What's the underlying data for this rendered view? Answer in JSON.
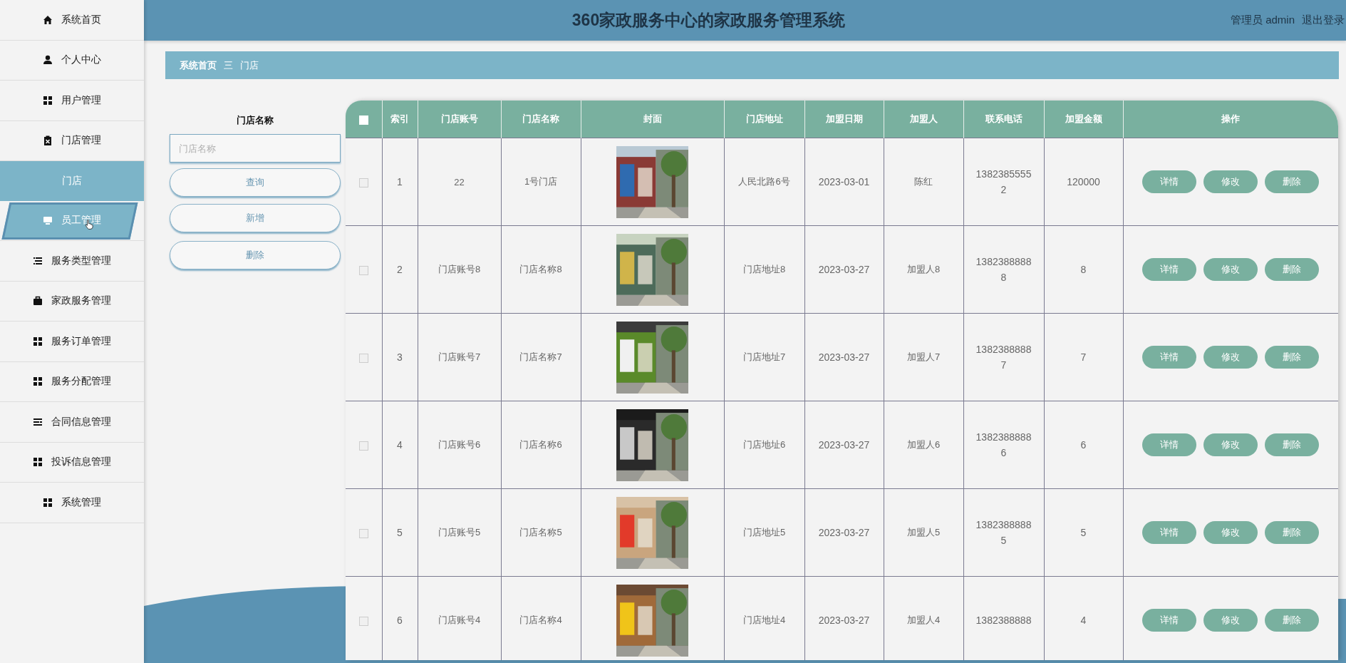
{
  "sidebar": {
    "items": [
      {
        "label": "系统首页",
        "kind": "home",
        "selected": false,
        "hovered": false
      },
      {
        "label": "个人中心",
        "kind": "person",
        "selected": false,
        "hovered": false
      },
      {
        "label": "用户管理",
        "kind": "grid",
        "selected": false,
        "hovered": false
      },
      {
        "label": "门店管理",
        "kind": "clipboard",
        "selected": false,
        "hovered": false,
        "children": [
          {
            "label": "门店",
            "selected": true
          }
        ]
      },
      {
        "label": "员工管理",
        "kind": "monitor",
        "selected": false,
        "hovered": true
      },
      {
        "label": "服务类型管理",
        "kind": "list",
        "selected": false,
        "hovered": false
      },
      {
        "label": "家政服务管理",
        "kind": "briefcase",
        "selected": false,
        "hovered": false
      },
      {
        "label": "服务订单管理",
        "kind": "grid",
        "selected": false,
        "hovered": false
      },
      {
        "label": "服务分配管理",
        "kind": "grid",
        "selected": false,
        "hovered": false
      },
      {
        "label": "合同信息管理",
        "kind": "lines",
        "selected": false,
        "hovered": false
      },
      {
        "label": "投诉信息管理",
        "kind": "grid",
        "selected": false,
        "hovered": false
      },
      {
        "label": "系统管理",
        "kind": "grid",
        "selected": false,
        "hovered": false
      }
    ]
  },
  "header": {
    "title": "360家政服务中心的家政服务管理系统",
    "user": "管理员 admin",
    "logout": "退出登录"
  },
  "breadcrumb": {
    "items": [
      "系统首页",
      "门店"
    ],
    "separator": "三"
  },
  "search": {
    "label": "门店名称",
    "placeholder": "门店名称",
    "buttons": [
      "查询",
      "新增",
      "删除"
    ]
  },
  "table": {
    "select_all": {
      "checked": false
    },
    "columns": [
      "索引",
      "门店账号",
      "门店名称",
      "封面",
      "门店地址",
      "加盟日期",
      "加盟人",
      "联系电话",
      "加盟金额",
      "操作"
    ],
    "rows": [
      {
        "checked": false,
        "index": "1",
        "account": "22",
        "name": "1号门店",
        "address": "人民北路6号",
        "date": "2023-03-01",
        "owner": "陈红",
        "phone": "13823855552",
        "amount": "120000",
        "actions": [
          "详情",
          "修改",
          "删除"
        ]
      },
      {
        "checked": false,
        "index": "2",
        "account": "门店账号8",
        "name": "门店名称8",
        "address": "门店地址8",
        "date": "2023-03-27",
        "owner": "加盟人8",
        "phone": "13823888888",
        "amount": "8",
        "actions": [
          "详情",
          "修改",
          "删除"
        ]
      },
      {
        "checked": false,
        "index": "3",
        "account": "门店账号7",
        "name": "门店名称7",
        "address": "门店地址7",
        "date": "2023-03-27",
        "owner": "加盟人7",
        "phone": "13823888887",
        "amount": "7",
        "actions": [
          "详情",
          "修改",
          "删除"
        ]
      },
      {
        "checked": false,
        "index": "4",
        "account": "门店账号6",
        "name": "门店名称6",
        "address": "门店地址6",
        "date": "2023-03-27",
        "owner": "加盟人6",
        "phone": "13823888886",
        "amount": "6",
        "actions": [
          "详情",
          "修改",
          "删除"
        ]
      },
      {
        "checked": false,
        "index": "5",
        "account": "门店账号5",
        "name": "门店名称5",
        "address": "门店地址5",
        "date": "2023-03-27",
        "owner": "加盟人5",
        "phone": "13823888885",
        "amount": "5",
        "actions": [
          "详情",
          "修改",
          "删除"
        ]
      },
      {
        "checked": false,
        "index": "6",
        "account": "门店账号4",
        "name": "门店名称4",
        "address": "门店地址4",
        "date": "2023-03-27",
        "owner": "加盟人4",
        "phone": "1382388888",
        "amount": "4",
        "actions": [
          "详情",
          "修改",
          "删除"
        ]
      }
    ]
  }
}
